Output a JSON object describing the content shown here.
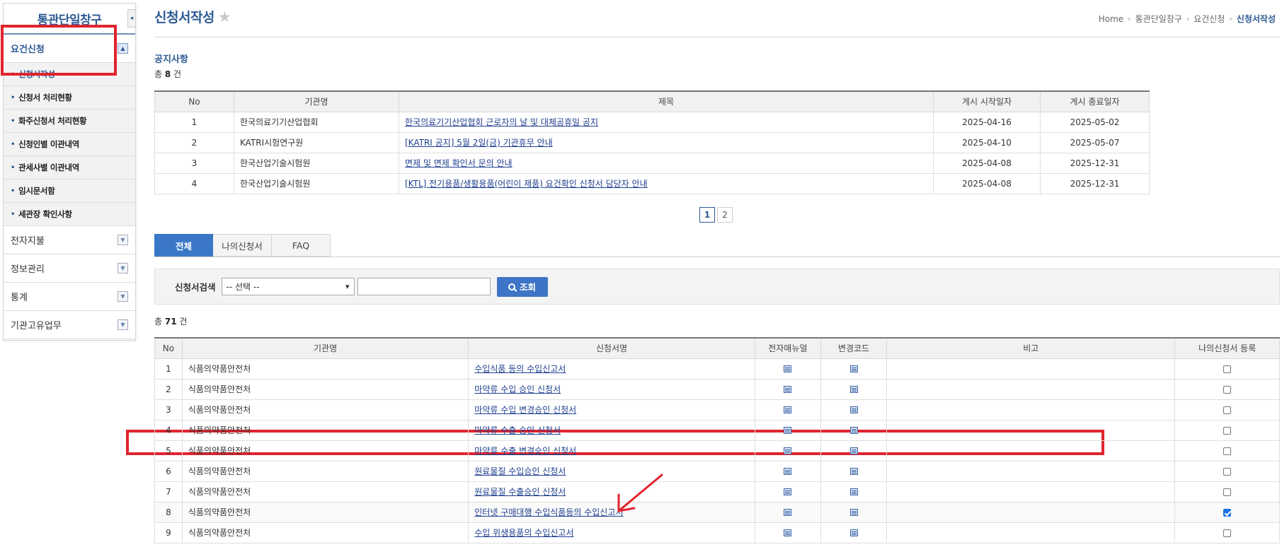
{
  "sidebar": {
    "title": "통관단일창구",
    "collapse_glyph": "◂",
    "group_open": {
      "label": "요건신청",
      "toggle": "▲"
    },
    "items": [
      {
        "label": "신청서작성",
        "active": true
      },
      {
        "label": "신청서 처리현황"
      },
      {
        "label": "화주신청서 처리현황"
      },
      {
        "label": "신청인별 이관내역"
      },
      {
        "label": "관세사별 이관내역"
      },
      {
        "label": "임시문서함"
      },
      {
        "label": "세관장 확인사항"
      }
    ],
    "groups": [
      {
        "label": "전자지불",
        "toggle": "▼"
      },
      {
        "label": "정보관리",
        "toggle": "▼"
      },
      {
        "label": "통계",
        "toggle": "▼"
      },
      {
        "label": "기관고유업무",
        "toggle": "▼"
      }
    ]
  },
  "header": {
    "title": "신청서작성",
    "star": "★",
    "breadcrumb": [
      "Home",
      "통관단일창구",
      "요건신청",
      "신청서작성"
    ],
    "sep": "›"
  },
  "notice": {
    "section": "공지사항",
    "count_prefix": "총 ",
    "count": "8",
    "count_suffix": " 건",
    "columns": [
      "No",
      "기관명",
      "제목",
      "게시 시작일자",
      "게시 종료일자"
    ],
    "rows": [
      {
        "no": "1",
        "org": "한국의료기기산업협회",
        "title": "한국의료기기산업협회 근로자의 날 및 대체공휴일 공지",
        "start": "2025-04-16",
        "end": "2025-05-02"
      },
      {
        "no": "2",
        "org": "KATRI시험연구원",
        "title": "[KATRI 공지] 5월 2일(금) 기관휴무 안내",
        "start": "2025-04-10",
        "end": "2025-05-07"
      },
      {
        "no": "3",
        "org": "한국산업기술시험원",
        "title": "면제 및 면제 확인서 문의 안내",
        "start": "2025-04-08",
        "end": "2025-12-31"
      },
      {
        "no": "4",
        "org": "한국산업기술시험원",
        "title": "[KTL] 전기용품/생활용품(어린이 제품) 요건확인 신청서 담당자 안내",
        "start": "2025-04-08",
        "end": "2025-12-31"
      }
    ],
    "pages": [
      "1",
      "2"
    ]
  },
  "tabs": [
    "전체",
    "나의신청서",
    "FAQ"
  ],
  "search": {
    "label": "신청서검색",
    "select_value": "-- 선택 --",
    "chevron": "⌄",
    "button": "조회"
  },
  "forms": {
    "count_prefix": "총 ",
    "count": "71",
    "count_suffix": " 건",
    "columns": [
      "No",
      "기관명",
      "신청서명",
      "전자매뉴얼",
      "변경코드",
      "비고",
      "나의신청서 등록"
    ],
    "rows": [
      {
        "no": "1",
        "org": "식품의약품안전처",
        "name": "수입식품 등의 수입신고서",
        "checked": false
      },
      {
        "no": "2",
        "org": "식품의약품안전처",
        "name": "마약류 수입 승인 신청서",
        "checked": false
      },
      {
        "no": "3",
        "org": "식품의약품안전처",
        "name": "마약류 수입 변경승인 신청서",
        "checked": false
      },
      {
        "no": "4",
        "org": "식품의약품안전처",
        "name": "마약류 수출 승인 신청서",
        "checked": false
      },
      {
        "no": "5",
        "org": "식품의약품안전처",
        "name": "마약류 수출 변경승인 신청서",
        "checked": false
      },
      {
        "no": "6",
        "org": "식품의약품안전처",
        "name": "원료물질 수입승인 신청서",
        "checked": false
      },
      {
        "no": "7",
        "org": "식품의약품안전처",
        "name": "원료물질 수출승인 신청서",
        "checked": false
      },
      {
        "no": "8",
        "org": "식품의약품안전처",
        "name": "인터넷 구매대행 수입식품등의 수입신고서",
        "checked": true
      },
      {
        "no": "9",
        "org": "식품의약품안전처",
        "name": "수입 위생용품의 수입신고서",
        "checked": false
      }
    ]
  },
  "colors": {
    "accent": "#2c5a93",
    "highlight": "#e0242e",
    "tab_active": "#3a78c7"
  }
}
